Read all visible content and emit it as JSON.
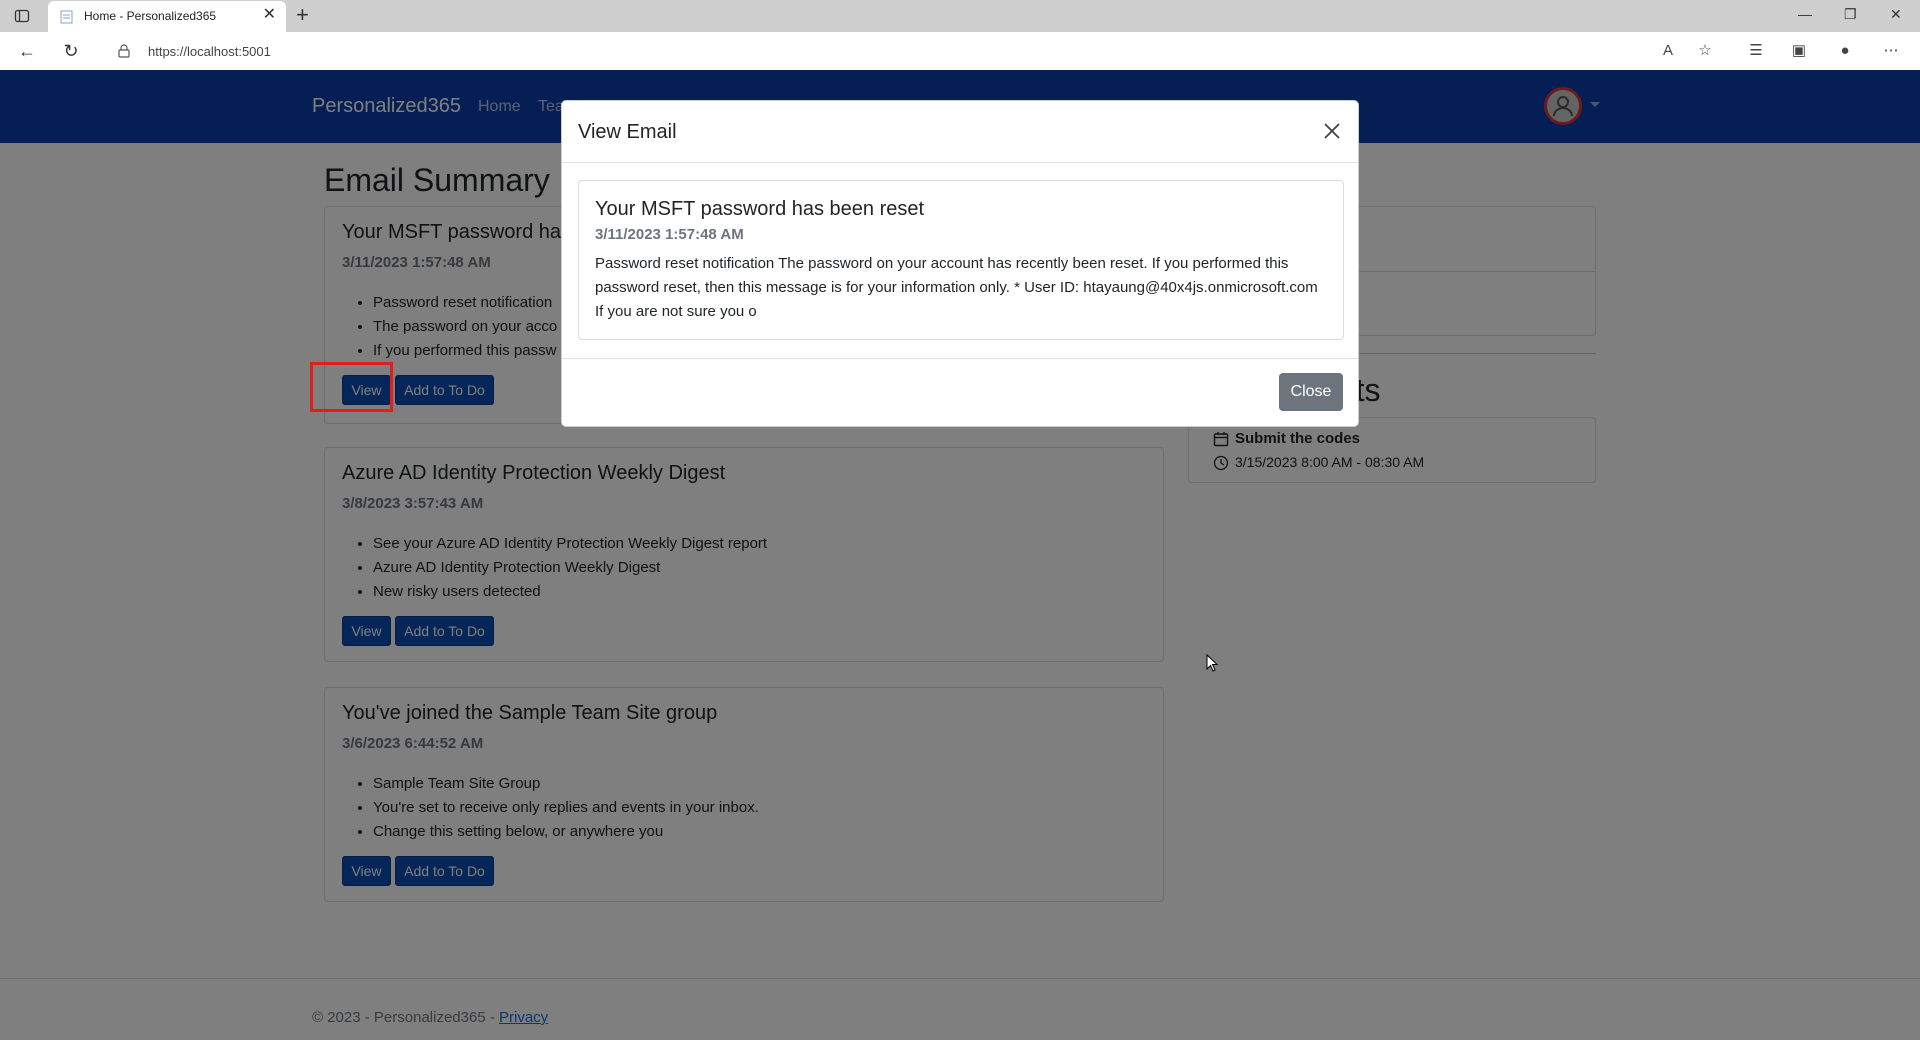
{
  "browser": {
    "tab_title": "Home - Personalized365",
    "url": "https://localhost:5001"
  },
  "navbar": {
    "brand": "Personalized365",
    "links": [
      "Home",
      "Tea"
    ]
  },
  "main": {
    "title": "Email Summary",
    "emails": [
      {
        "title": "Your MSFT password has",
        "date": "3/11/2023 1:57:48 AM",
        "bullets": [
          "Password reset notification",
          "The password on your acco",
          "If you performed this passw"
        ],
        "view_label": "View",
        "todo_label": "Add to To Do"
      },
      {
        "title": "Azure AD Identity Protection Weekly Digest",
        "date": "3/8/2023 3:57:43 AM",
        "bullets": [
          "See your Azure AD Identity Protection Weekly Digest report",
          "Azure AD Identity Protection Weekly Digest",
          "New risky users detected"
        ],
        "view_label": "View",
        "todo_label": "Add to To Do"
      },
      {
        "title": "You've joined the Sample Team Site group",
        "date": "3/6/2023 6:44:52 AM",
        "bullets": [
          "Sample Team Site Group",
          "You're set to receive only replies and events in your inbox.",
          "Change this setting below, or anywhere you"
        ],
        "view_label": "View",
        "todo_label": "Add to To Do"
      }
    ]
  },
  "sidebar": {
    "events_title": "ents",
    "event": {
      "name": "Submit the codes",
      "time": "3/15/2023 8:00 AM - 08:30 AM"
    }
  },
  "footer": {
    "text": "© 2023 - Personalized365 - ",
    "privacy": "Privacy"
  },
  "modal": {
    "title": "View Email",
    "email_title": "Your MSFT password has been reset",
    "email_date": "3/11/2023 1:57:48 AM",
    "email_body": "Password reset notification The password on your account has recently been reset. If you performed this password reset, then this message is for your information only. * User ID: htayaung@40x4js.onmicrosoft.com If you are not sure you o",
    "close_label": "Close"
  },
  "colors": {
    "navbar": "#0a3da8",
    "primary_button": "#0d4bb0",
    "secondary_button": "#6c757d",
    "highlight": "#e11d1d"
  }
}
